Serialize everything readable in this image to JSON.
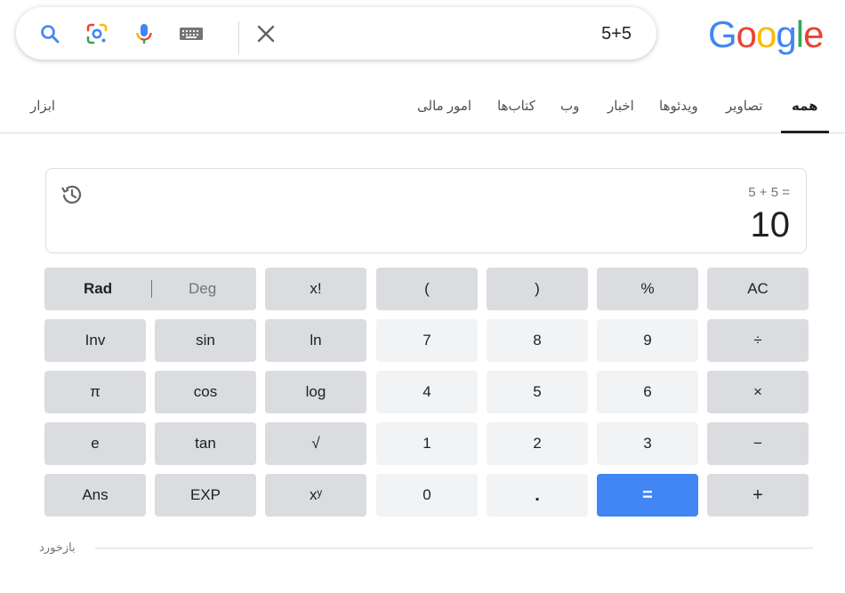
{
  "search": {
    "query": "5+5",
    "icons": [
      "search-icon",
      "google-lens-icon",
      "microphone-icon",
      "keyboard-icon",
      "close-icon"
    ]
  },
  "logo": {
    "text": "Google",
    "letters": [
      {
        "char": "G",
        "color": "#4285F4"
      },
      {
        "char": "o",
        "color": "#EA4335"
      },
      {
        "char": "o",
        "color": "#FBBC05"
      },
      {
        "char": "g",
        "color": "#4285F4"
      },
      {
        "char": "l",
        "color": "#34A853"
      },
      {
        "char": "e",
        "color": "#EA4335"
      }
    ]
  },
  "tabs": {
    "all": "همه",
    "images": "تصاویر",
    "videos": "ویدئوها",
    "news": "اخبار",
    "web": "وب",
    "books": "کتاب‌ها",
    "finance": "امور مالی",
    "tools": "ابزار"
  },
  "calculator": {
    "expression": "5 + 5 =",
    "result": "10",
    "keys": {
      "rad": "Rad",
      "deg": "Deg",
      "fact": "x!",
      "lparen": "(",
      "rparen": ")",
      "percent": "%",
      "ac": "AC",
      "inv": "Inv",
      "sin": "sin",
      "ln": "ln",
      "k7": "7",
      "k8": "8",
      "k9": "9",
      "div": "÷",
      "pi": "π",
      "cos": "cos",
      "log": "log",
      "k4": "4",
      "k5": "5",
      "k6": "6",
      "mul": "×",
      "e": "e",
      "tan": "tan",
      "sqrt": "√",
      "k1": "1",
      "k2": "2",
      "k3": "3",
      "sub": "−",
      "ans": "Ans",
      "exp": "EXP",
      "pow": "xʸ",
      "k0": "0",
      "dot": ".",
      "eq": "=",
      "add": "+"
    }
  },
  "footer": {
    "feedback": "بازخورد"
  },
  "colors": {
    "accent": "#4285F4",
    "op_key": "#DADCE0",
    "num_key": "#F1F3F4"
  }
}
